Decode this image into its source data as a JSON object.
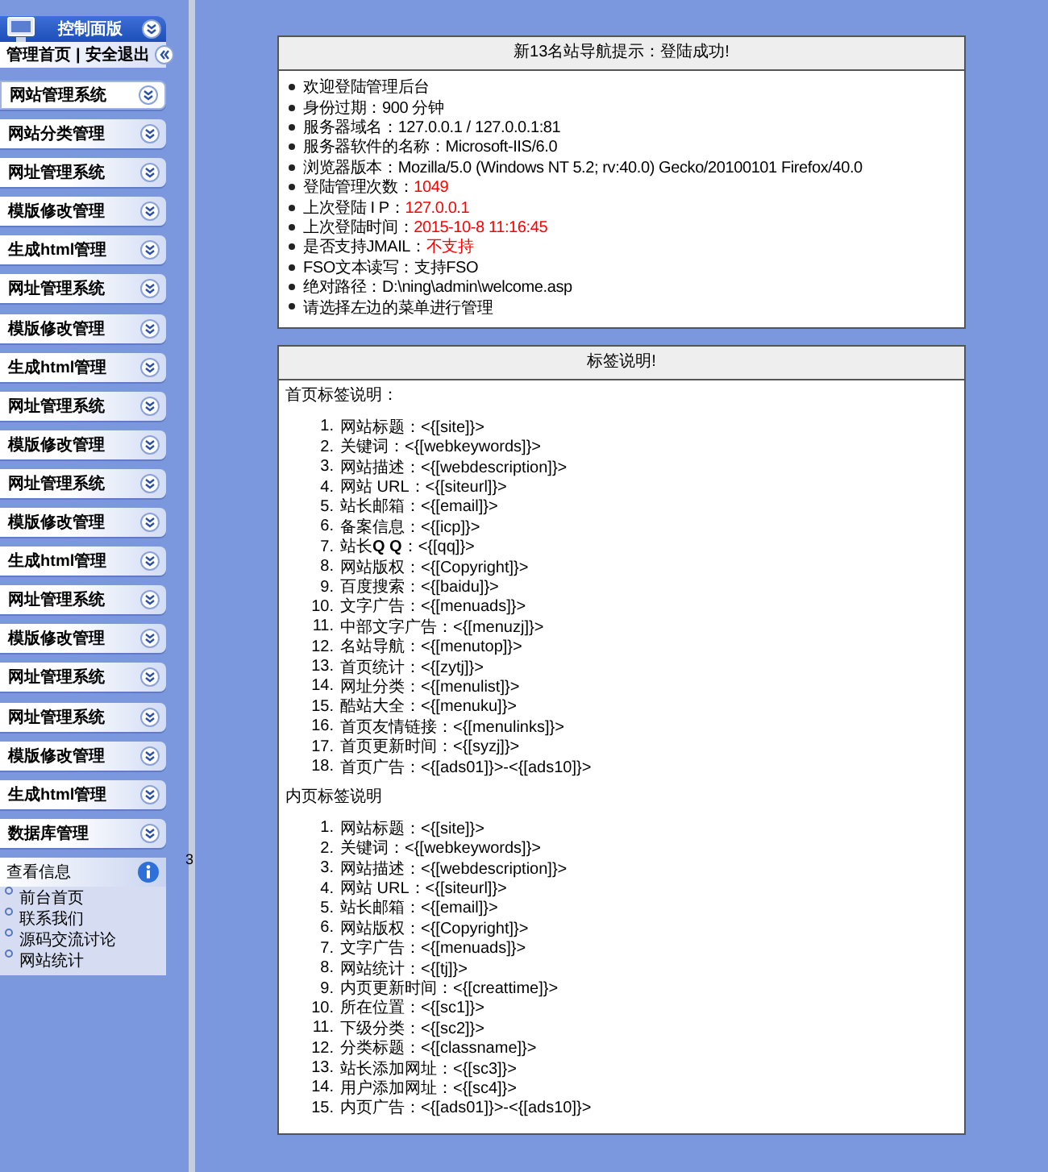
{
  "sidebar": {
    "title": "控制面版",
    "top_links": [
      "管理首页",
      "安全退出"
    ],
    "top_separator": "|",
    "menus": [
      {
        "label": "网站管理系统",
        "selected": true
      },
      {
        "label": "网站分类管理",
        "selected": false
      },
      {
        "label": "网址管理系统",
        "selected": false
      },
      {
        "label": "模版修改管理",
        "selected": false
      },
      {
        "label": "生成html管理",
        "selected": false
      },
      {
        "label": "网址管理系统",
        "selected": false
      },
      {
        "label": "模版修改管理",
        "selected": false
      },
      {
        "label": "生成html管理",
        "selected": false
      },
      {
        "label": "网址管理系统",
        "selected": false
      },
      {
        "label": "模版修改管理",
        "selected": false
      },
      {
        "label": "网址管理系统",
        "selected": false
      },
      {
        "label": "模版修改管理",
        "selected": false
      },
      {
        "label": "生成html管理",
        "selected": false
      },
      {
        "label": "网址管理系统",
        "selected": false
      },
      {
        "label": "模版修改管理",
        "selected": false
      },
      {
        "label": "网址管理系统",
        "selected": false
      },
      {
        "label": "网址管理系统",
        "selected": false
      },
      {
        "label": "模版修改管理",
        "selected": false
      },
      {
        "label": "生成html管理",
        "selected": false
      },
      {
        "label": "数据库管理",
        "selected": false
      }
    ],
    "info_panel": {
      "title": "查看信息",
      "links": [
        "前台首页",
        "联系我们",
        "源码交流讨论",
        "网站统计"
      ]
    }
  },
  "divider_text": "3",
  "status_panel": {
    "title": "新13名站导航提示：登陆成功!",
    "items": [
      {
        "label": "欢迎登陆管理后台"
      },
      {
        "label": "身份过期：",
        "value": "900 分钟",
        "highlight": false
      },
      {
        "label": "服务器域名：",
        "value": "127.0.0.1 / 127.0.0.1:81",
        "highlight": false
      },
      {
        "label": "服务器软件的名称：",
        "value": "Microsoft-IIS/6.0",
        "highlight": false
      },
      {
        "label": "浏览器版本：",
        "value": "Mozilla/5.0 (Windows NT 5.2; rv:40.0) Gecko/20100101 Firefox/40.0",
        "highlight": false
      },
      {
        "label": "登陆管理次数：",
        "value": "1049",
        "highlight": true
      },
      {
        "label": "上次登陆 I P：",
        "value": "127.0.0.1",
        "highlight": true
      },
      {
        "label": "上次登陆时间：",
        "value": "2015-10-8 11:16:45",
        "highlight": true
      },
      {
        "label": "是否支持JMAIL：",
        "value": "不支持",
        "highlight": true
      },
      {
        "label": "FSO文本读写：",
        "value": "支持FSO",
        "highlight": false
      },
      {
        "label": "绝对路径：",
        "value": "D:\\ning\\admin\\welcome.asp",
        "highlight": false
      },
      {
        "label": "请选择左边的菜单进行管理"
      }
    ]
  },
  "tags_panel": {
    "title": "标签说明!",
    "sections": [
      {
        "heading": "首页标签说明：",
        "items": [
          {
            "number": "1.",
            "text": "网站标题：<{[site]}>"
          },
          {
            "number": "2.",
            "text": "关键词：<{[webkeywords]}>"
          },
          {
            "number": "3.",
            "text": "网站描述：<{[webdescription]}>"
          },
          {
            "number": "4.",
            "text": "网站 URL：<{[siteurl]}>"
          },
          {
            "number": "5.",
            "text": "站长邮箱：<{[email]}>"
          },
          {
            "number": "6.",
            "text": "备案信息：<{[icp]}>"
          },
          {
            "number": "7.",
            "text": "站长**Q Q**：<{[qq]}>"
          },
          {
            "number": "8.",
            "text": "网站版权：<{[Copyright]}>"
          },
          {
            "number": "9.",
            "text": "百度搜索：<{[baidu]}>"
          },
          {
            "number": "10.",
            "text": "文字广告：<{[menuads]}>"
          },
          {
            "number": "11.",
            "text": "中部文字广告：<{[menuzj]}>"
          },
          {
            "number": "12.",
            "text": "名站导航：<{[menutop]}>"
          },
          {
            "number": "13.",
            "text": "首页统计：<{[zytj]}>"
          },
          {
            "number": "14.",
            "text": "网址分类：<{[menulist]}>"
          },
          {
            "number": "15.",
            "text": "酷站大全：<{[menuku]}>"
          },
          {
            "number": "16.",
            "text": "首页友情链接：<{[menulinks]}>"
          },
          {
            "number": "17.",
            "text": "首页更新时间：<{[syzj]}>"
          },
          {
            "number": "18.",
            "text": "首页广告：<{[ads01]}>-<{[ads10]}>"
          }
        ]
      },
      {
        "heading": "内页标签说明",
        "items": [
          {
            "number": "1.",
            "text": "网站标题：<{[site]}>"
          },
          {
            "number": "2.",
            "text": "关键词：<{[webkeywords]}>"
          },
          {
            "number": "3.",
            "text": "网站描述：<{[webdescription]}>"
          },
          {
            "number": "4.",
            "text": "网站 URL：<{[siteurl]}>"
          },
          {
            "number": "5.",
            "text": "站长邮箱：<{[email]}>"
          },
          {
            "number": "6.",
            "text": "网站版权：<{[Copyright]}>"
          },
          {
            "number": "7.",
            "text": "文字广告：<{[menuads]}>"
          },
          {
            "number": "8.",
            "text": "网站统计：<{[tj]}>"
          },
          {
            "number": "9.",
            "text": "内页更新时间：<{[creattime]}>"
          },
          {
            "number": "10.",
            "text": "所在位置：<{[sc1]}>"
          },
          {
            "number": "11.",
            "text": "下级分类：<{[sc2]}>"
          },
          {
            "number": "12.",
            "text": "分类标题：<{[classname]}>"
          },
          {
            "number": "13.",
            "text": "站长添加网址：<{[sc3]}>"
          },
          {
            "number": "14.",
            "text": "用户添加网址：<{[sc4]}>"
          },
          {
            "number": "15.",
            "text": "内页广告：<{[ads01]}>-<{[ads10]}>"
          }
        ]
      }
    ]
  }
}
